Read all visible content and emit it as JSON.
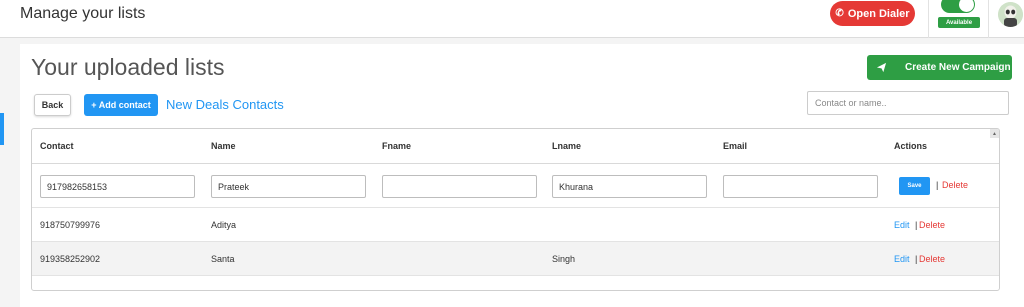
{
  "header": {
    "title": "Manage your lists",
    "dialer_label": "Open Dialer",
    "status_label": "Available"
  },
  "panel": {
    "title": "Your uploaded lists",
    "create_campaign_label": "Create New Campaign",
    "back_label": "Back",
    "add_contact_label": "+ Add contact",
    "list_name": "New Deals Contacts",
    "search_placeholder": "Contact or name.."
  },
  "table": {
    "columns": [
      "Contact",
      "Name",
      "Fname",
      "Lname",
      "Email",
      "Actions"
    ],
    "edit_row": {
      "contact": "917982658153",
      "name": "Prateek",
      "fname": "",
      "lname": "Khurana",
      "email": "",
      "save_label": "Save",
      "separator": "|",
      "delete_label": "Delete"
    },
    "rows": [
      {
        "contact": "918750799976",
        "name": "Aditya",
        "fname": "",
        "lname": "",
        "email": "",
        "edit_label": "Edit",
        "separator": "|",
        "delete_label": "Delete"
      },
      {
        "contact": "919358252902",
        "name": "Santa",
        "fname": "",
        "lname": "Singh",
        "email": "",
        "edit_label": "Edit",
        "separator": "|",
        "delete_label": "Delete"
      }
    ]
  },
  "colors": {
    "accent": "#2196f3",
    "success": "#2e9e44",
    "danger": "#e53935"
  },
  "icons": [
    "phone-icon",
    "send-icon",
    "avatar-icon",
    "scroll-up-icon"
  ]
}
